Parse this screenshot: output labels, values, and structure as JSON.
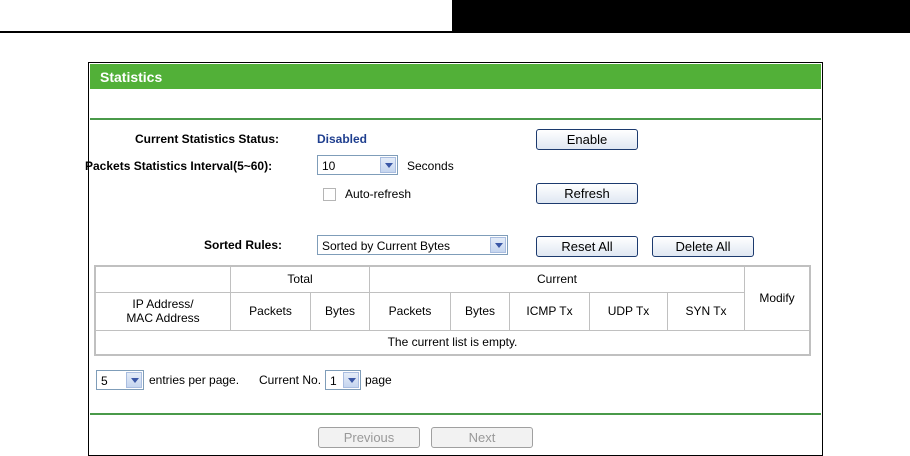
{
  "panel": {
    "title": "Statistics"
  },
  "status": {
    "label": "Current Statistics Status:",
    "value": "Disabled",
    "enable_button": "Enable"
  },
  "interval": {
    "label": "Packets Statistics Interval(5~60):",
    "value": "10",
    "unit": "Seconds",
    "auto_refresh_label": "Auto-refresh",
    "auto_refresh_checked": false,
    "refresh_button": "Refresh"
  },
  "sorted": {
    "label": "Sorted Rules:",
    "value": "Sorted by Current Bytes",
    "reset_all_button": "Reset All",
    "delete_all_button": "Delete All"
  },
  "table": {
    "group_total": "Total",
    "group_current": "Current",
    "modify": "Modify",
    "col_ip_line1": "IP Address/",
    "col_ip_line2": "MAC Address",
    "total_packets": "Packets",
    "total_bytes": "Bytes",
    "current_packets": "Packets",
    "current_bytes": "Bytes",
    "icmp": "ICMP Tx",
    "udp": "UDP Tx",
    "syn": "SYN Tx",
    "empty_message": "The current list is empty."
  },
  "pagination": {
    "entries_value": "5",
    "entries_label": "entries per page.",
    "current_label": "Current No.",
    "current_value": "1",
    "page_label": "page",
    "previous_button": "Previous",
    "next_button": "Next"
  },
  "colors": {
    "title_bar": "#52b038",
    "status_text": "#1f3f8f",
    "divider": "#4a9a4a"
  }
}
